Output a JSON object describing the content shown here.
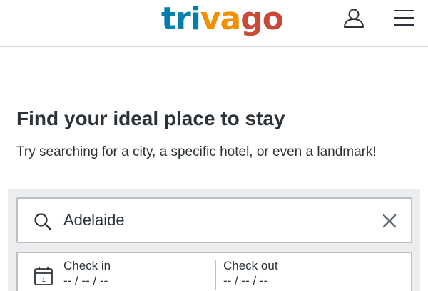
{
  "header": {
    "logo": {
      "letters": [
        "tri",
        "va",
        "go"
      ],
      "colors": [
        "#007fad",
        "#f48f00",
        "#c94a38"
      ]
    },
    "user_icon": "user-icon",
    "menu_icon": "hamburger-menu-icon"
  },
  "main": {
    "headline": "Find your ideal place to stay",
    "subline": "Try searching for a city, a specific hotel, or even a landmark!"
  },
  "search": {
    "value": "Adelaide",
    "search_icon": "search-icon",
    "clear_icon": "close-icon"
  },
  "dates": {
    "calendar_icon": "calendar-icon",
    "check_in_label": "Check in",
    "check_in_value": "-- / -- / --",
    "check_out_label": "Check out",
    "check_out_value": "-- / -- / --"
  },
  "colors": {
    "text": "#2c3338",
    "border": "#bcc0c4",
    "panel_bg": "#ebedee"
  }
}
